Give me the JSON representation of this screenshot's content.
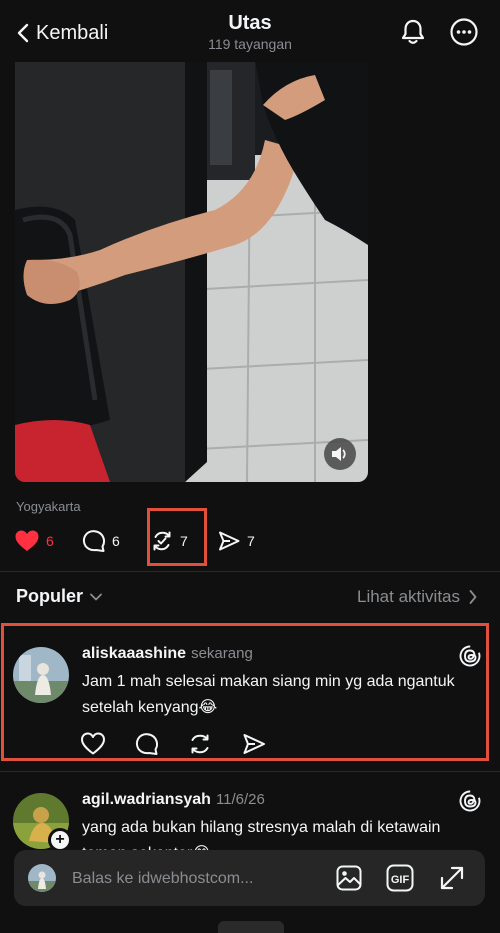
{
  "header": {
    "back_label": "Kembali",
    "title": "Utas",
    "subtitle": "119 tayangan"
  },
  "post": {
    "location": "Yogyakarta",
    "likes": "6",
    "comments": "6",
    "reposts": "7",
    "shares": "7",
    "liked": true
  },
  "replies_header": {
    "sort_label": "Populer",
    "activity_label": "Lihat aktivitas"
  },
  "comments": [
    {
      "username": "aliskaaashine",
      "time": "sekarang",
      "text": "Jam 1 mah selesai makan siang min yg ada ngantuk setelah kenyang😂"
    },
    {
      "username": "agil.wadriansyah",
      "time": "11/6/26",
      "text": "yang ada bukan hilang stresnya malah di ketawain teman sekantor😂"
    }
  ],
  "reply_bar": {
    "placeholder": "Balas ke idwebhostcom..."
  },
  "colors": {
    "background": "#101010",
    "like_red": "#ff3040",
    "highlight": "#e0503c",
    "muted_text": "#8a8d91"
  }
}
